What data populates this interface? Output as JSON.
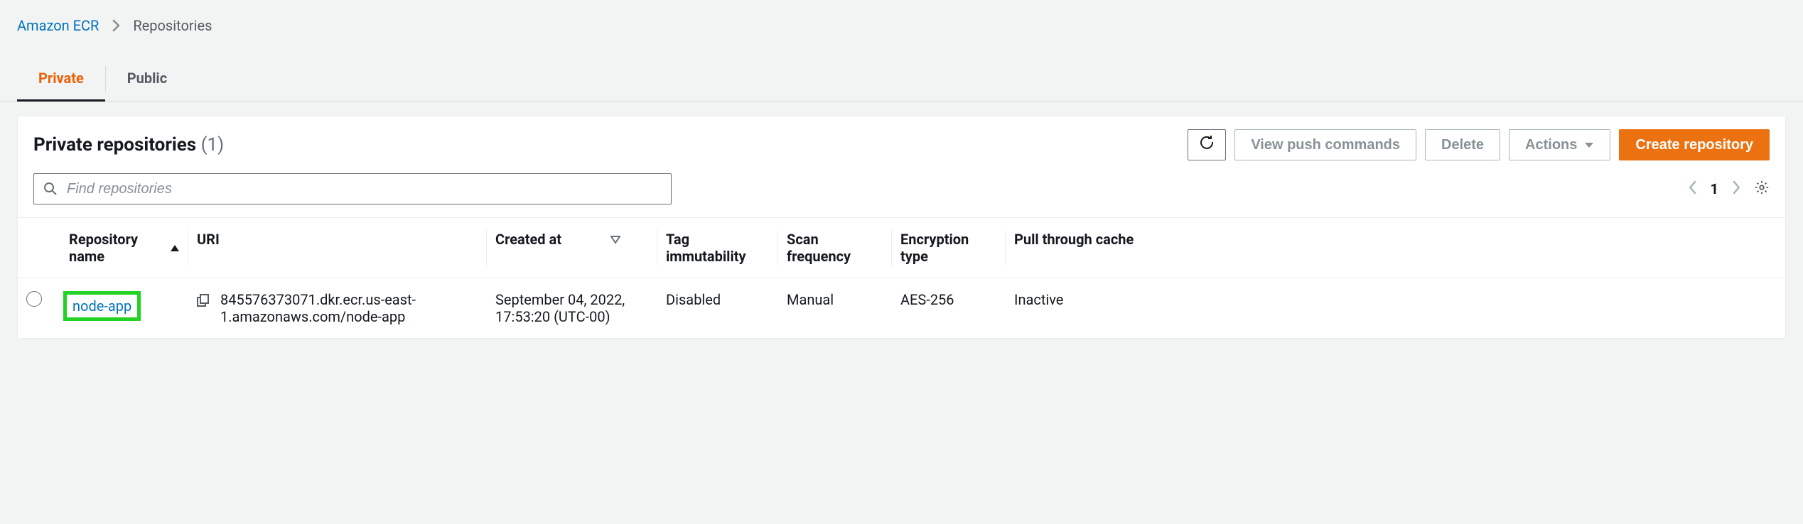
{
  "breadcrumb": {
    "root": "Amazon ECR",
    "current": "Repositories"
  },
  "tabs": {
    "private": "Private",
    "public": "Public"
  },
  "panel": {
    "title": "Private repositories",
    "count": "(1)"
  },
  "buttons": {
    "view_push": "View push commands",
    "delete": "Delete",
    "actions": "Actions",
    "create": "Create repository"
  },
  "search": {
    "placeholder": "Find repositories"
  },
  "pager": {
    "page": "1"
  },
  "columns": {
    "name": "Repository name",
    "uri": "URI",
    "created": "Created at",
    "tag": "Tag immutability",
    "scan": "Scan frequency",
    "enc": "Encryption type",
    "pull": "Pull through cache"
  },
  "rows": [
    {
      "name": "node-app",
      "uri": "845576373071.dkr.ecr.us-east-1.amazonaws.com/node-app",
      "created": "September 04, 2022, 17:53:20 (UTC-00)",
      "tag": "Disabled",
      "scan": "Manual",
      "enc": "AES-256",
      "pull": "Inactive"
    }
  ]
}
